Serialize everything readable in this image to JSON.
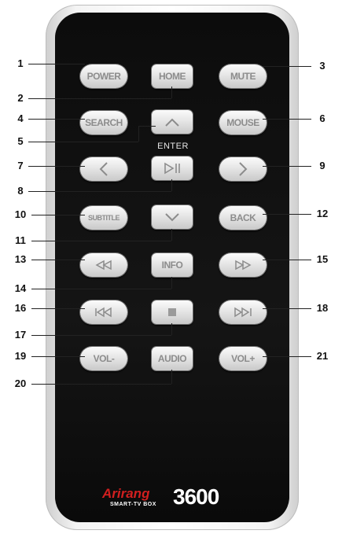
{
  "buttons": {
    "power": "POWER",
    "home": "HOME",
    "mute": "MUTE",
    "search": "SEARCH",
    "mouse": "MOUSE",
    "subtitle": "SUBTITLE",
    "back": "BACK",
    "info": "INFO",
    "vol_minus": "VOL-",
    "audio": "AUDIO",
    "vol_plus": "VOL+"
  },
  "enter_label": "ENTER",
  "callouts": [
    "1",
    "2",
    "3",
    "4",
    "5",
    "6",
    "7",
    "8",
    "9",
    "10",
    "11",
    "12",
    "13",
    "14",
    "15",
    "16",
    "17",
    "18",
    "19",
    "20",
    "21"
  ],
  "logo": {
    "brand": "Arirang",
    "tagline": "SMART-TV BOX",
    "model": "3600"
  },
  "icons": {
    "up": "chevron-up-icon",
    "left": "chevron-left-icon",
    "right": "chevron-right-icon",
    "down": "chevron-down-icon",
    "play_pause": "play-pause-icon",
    "rewind": "rewind-icon",
    "fast_forward": "fast-forward-icon",
    "previous": "skip-previous-icon",
    "stop": "stop-icon",
    "next": "skip-next-icon"
  },
  "colors": {
    "body": "#111111",
    "button": "#e6e6e6",
    "brand_red": "#d21f1f"
  }
}
